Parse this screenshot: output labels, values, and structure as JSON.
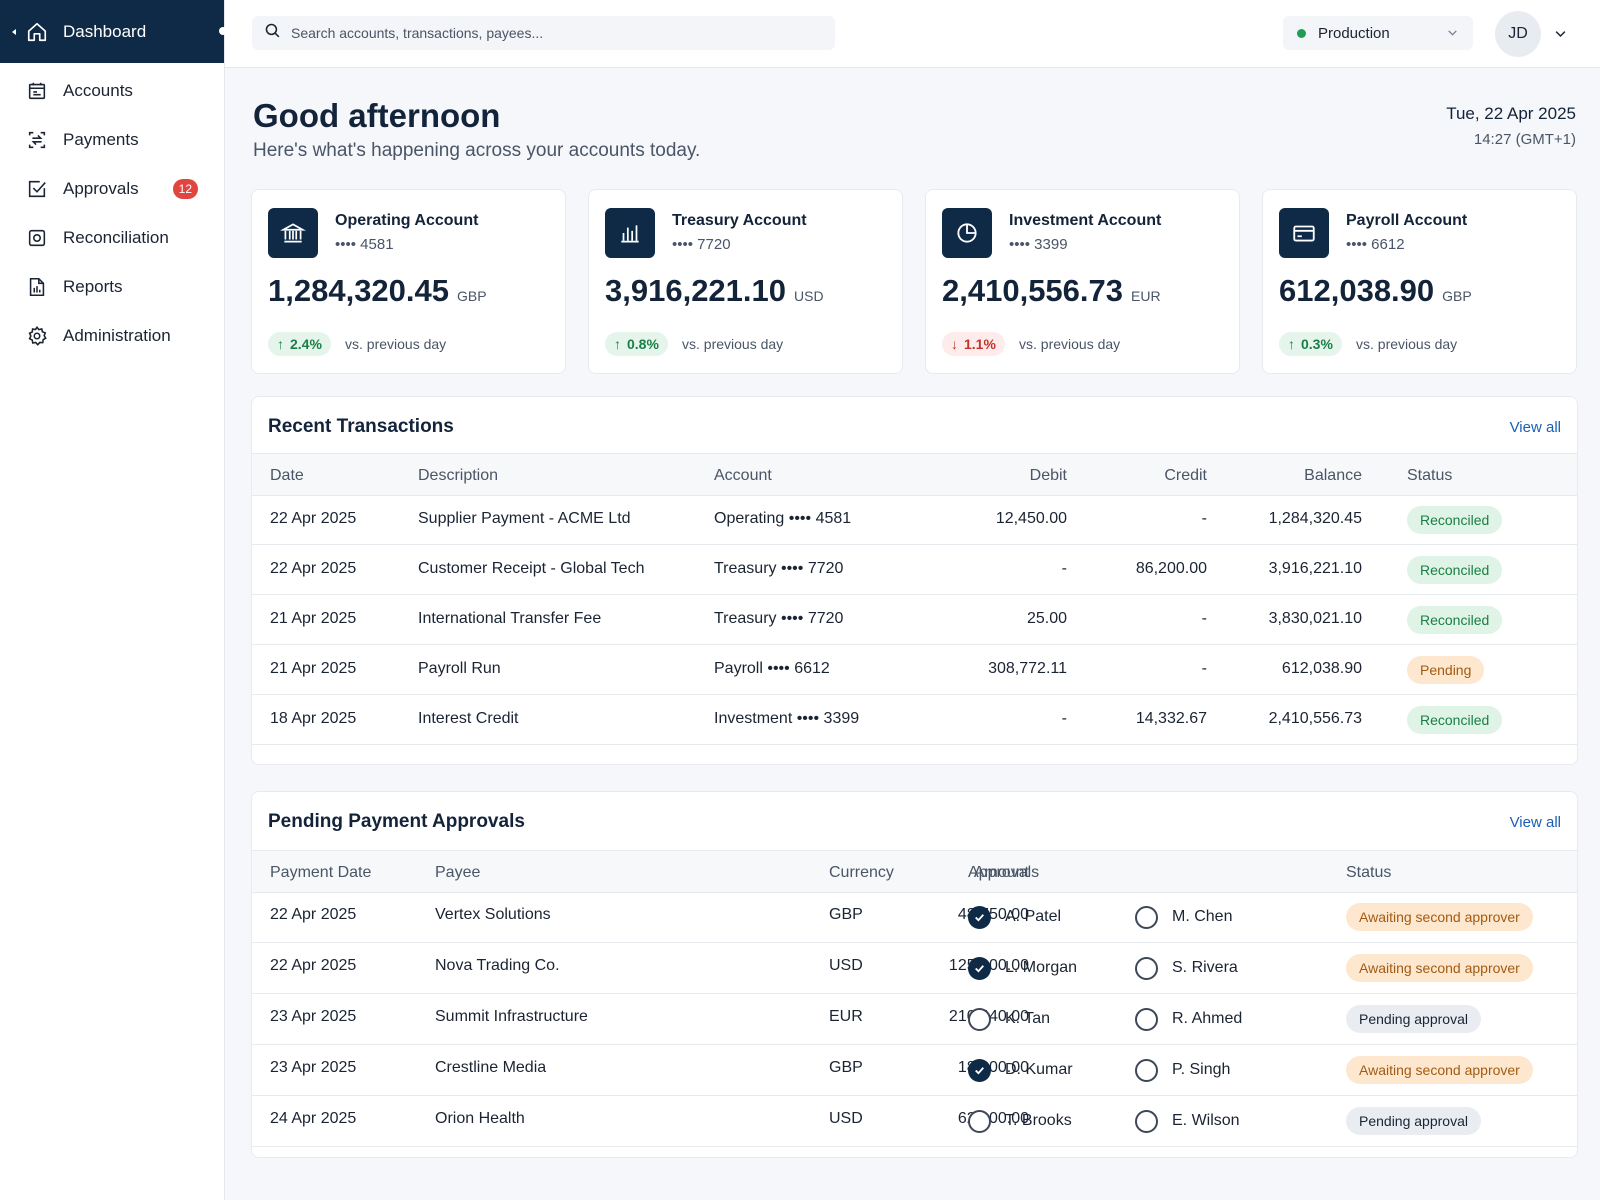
{
  "nav": {
    "items": [
      {
        "label": "Dashboard",
        "icon": "home-icon",
        "active": true
      },
      {
        "label": "Accounts",
        "icon": "ledger-icon"
      },
      {
        "label": "Payments",
        "icon": "transfer-icon"
      },
      {
        "label": "Approvals",
        "icon": "check-square-icon",
        "badge": "12"
      },
      {
        "label": "Reconciliation",
        "icon": "reconcile-icon"
      },
      {
        "label": "Reports",
        "icon": "report-chart-icon"
      },
      {
        "label": "Administration",
        "icon": "gear-icon"
      }
    ]
  },
  "topbar": {
    "search_placeholder": "Search accounts, transactions, payees...",
    "environment": "Production",
    "user_initials": "JD"
  },
  "header": {
    "greeting": "Good afternoon",
    "subtitle": "Here's what's happening across your accounts today.",
    "date": "Tue, 22 Apr 2025",
    "time": "14:27 (GMT+1)"
  },
  "accounts": [
    {
      "name": "Operating Account",
      "number": "•••• 4581",
      "balance": "1,284,320.45",
      "currency": "GBP",
      "change": "2.4%",
      "direction": "up",
      "change_label": "vs. previous day",
      "icon": "bank-icon"
    },
    {
      "name": "Treasury Account",
      "number": "•••• 7720",
      "balance": "3,916,221.10",
      "currency": "USD",
      "change": "0.8%",
      "direction": "up",
      "change_label": "vs. previous day",
      "icon": "bar-chart-icon"
    },
    {
      "name": "Investment Account",
      "number": "•••• 3399",
      "balance": "2,410,556.73",
      "currency": "EUR",
      "change": "1.1%",
      "direction": "down",
      "change_label": "vs. previous day",
      "icon": "pie-chart-icon"
    },
    {
      "name": "Payroll Account",
      "number": "•••• 6612",
      "balance": "612,038.90",
      "currency": "GBP",
      "change": "0.3%",
      "direction": "up",
      "change_label": "vs. previous day",
      "icon": "card-icon"
    }
  ],
  "transactions": {
    "title": "Recent Transactions",
    "view_all": "View all",
    "columns": [
      "Date",
      "Description",
      "Account",
      "Debit",
      "Credit",
      "Balance",
      "Status"
    ],
    "rows": [
      {
        "date": "22 Apr 2025",
        "description": "Supplier Payment - ACME Ltd",
        "account": "Operating •••• 4581",
        "debit": "12,450.00",
        "credit": "-",
        "balance": "1,284,320.45",
        "status": "Reconciled",
        "tone": "green"
      },
      {
        "date": "22 Apr 2025",
        "description": "Customer Receipt - Global Tech",
        "account": "Treasury •••• 7720",
        "debit": "-",
        "credit": "86,200.00",
        "balance": "3,916,221.10",
        "status": "Reconciled",
        "tone": "green"
      },
      {
        "date": "21 Apr 2025",
        "description": "International Transfer Fee",
        "account": "Treasury •••• 7720",
        "debit": "25.00",
        "credit": "-",
        "balance": "3,830,021.10",
        "status": "Reconciled",
        "tone": "green"
      },
      {
        "date": "21 Apr 2025",
        "description": "Payroll Run",
        "account": "Payroll •••• 6612",
        "debit": "308,772.11",
        "credit": "-",
        "balance": "612,038.90",
        "status": "Pending",
        "tone": "amber"
      },
      {
        "date": "18 Apr 2025",
        "description": "Interest Credit",
        "account": "Investment •••• 3399",
        "debit": "-",
        "credit": "14,332.67",
        "balance": "2,410,556.73",
        "status": "Reconciled",
        "tone": "green"
      }
    ]
  },
  "approvals": {
    "title": "Pending Payment Approvals",
    "view_all": "View all",
    "columns": [
      "Payment Date",
      "Payee",
      "Amount",
      "Currency",
      "Approvals",
      "Status"
    ],
    "rows": [
      {
        "date": "22 Apr 2025",
        "payee": "Vertex Solutions",
        "amount": "48,750.00",
        "currency": "GBP",
        "approver1": "A. Patel",
        "approved1": true,
        "approver2": "M. Chen",
        "approved2": false,
        "status": "Awaiting second approver",
        "tone": "amber"
      },
      {
        "date": "22 Apr 2025",
        "payee": "Nova Trading Co.",
        "amount": "125,000.00",
        "currency": "USD",
        "approver1": "L. Morgan",
        "approved1": true,
        "approver2": "S. Rivera",
        "approved2": false,
        "status": "Awaiting second approver",
        "tone": "amber"
      },
      {
        "date": "23 Apr 2025",
        "payee": "Summit Infrastructure",
        "amount": "210,440.00",
        "currency": "EUR",
        "approver1": "K. Tan",
        "approved1": false,
        "approver2": "R. Ahmed",
        "approved2": false,
        "status": "Pending approval",
        "tone": "grey"
      },
      {
        "date": "23 Apr 2025",
        "payee": "Crestline Media",
        "amount": "18,300.00",
        "currency": "GBP",
        "approver1": "D. Kumar",
        "approved1": true,
        "approver2": "P. Singh",
        "approved2": false,
        "status": "Awaiting second approver",
        "tone": "amber"
      },
      {
        "date": "24 Apr 2025",
        "payee": "Orion Health",
        "amount": "62,900.00",
        "currency": "USD",
        "approver1": "T. Brooks",
        "approved1": false,
        "approver2": "E. Wilson",
        "approved2": false,
        "status": "Pending approval",
        "tone": "grey"
      }
    ]
  },
  "colors": {
    "navy": "#0f2a47",
    "positive": "#1a7f45",
    "negative": "#c4342c",
    "link": "#1a5fb4",
    "badge": "#e0463f"
  }
}
